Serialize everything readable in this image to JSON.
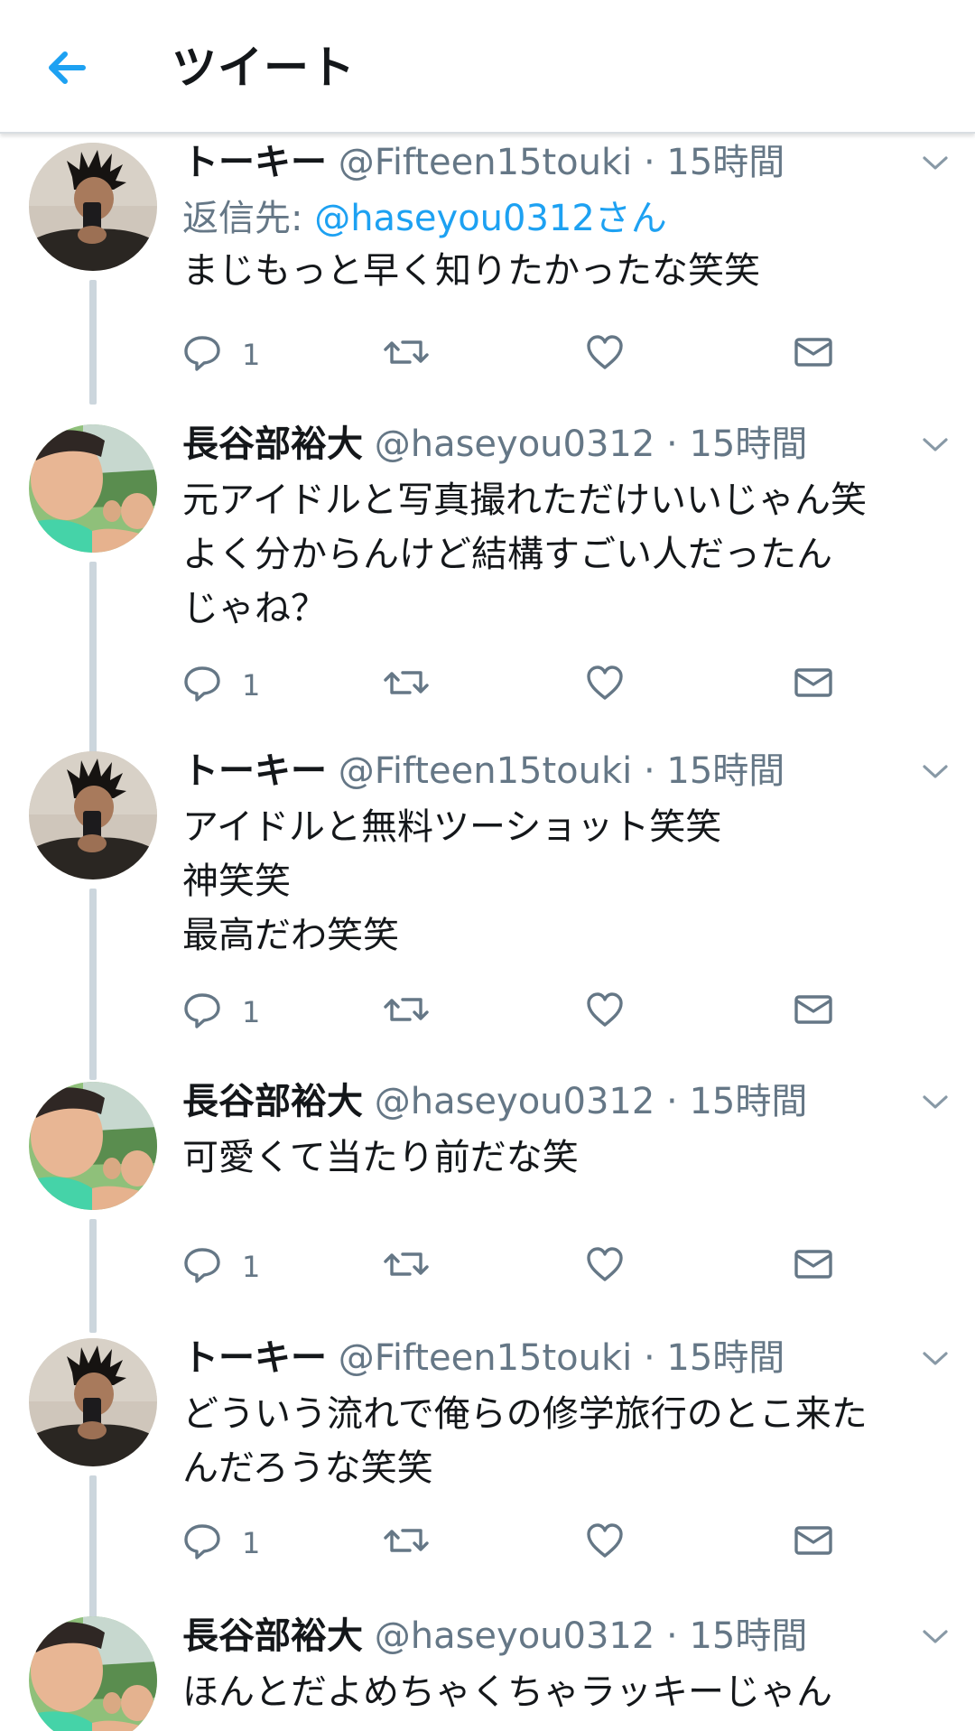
{
  "header": {
    "title": "ツイート",
    "back_icon": "arrow-left-icon",
    "accent_color": "#1da1f2"
  },
  "tweets": [
    {
      "name": "トーキー",
      "handle": "@Fifteen15touki",
      "separator": "·",
      "time": "15時間",
      "reply_to_prefix": "返信先: ",
      "reply_to_mention": "@haseyou0312さん",
      "lines": [
        "まじもっと早く知りたかったな笑笑"
      ],
      "reply_count": "1",
      "avatar": "avatar-touki"
    },
    {
      "name": "長谷部裕大",
      "handle": "@haseyou0312",
      "separator": "·",
      "time": "15時間",
      "lines": [
        "元アイドルと写真撮れただけいいじゃん笑",
        "よく分からんけど結構すごい人だったん",
        "じゃね？"
      ],
      "reply_count": "1",
      "avatar": "avatar-haseyou"
    },
    {
      "name": "トーキー",
      "handle": "@Fifteen15touki",
      "separator": "·",
      "time": "15時間",
      "lines": [
        "アイドルと無料ツーショット笑笑",
        "神笑笑",
        "最高だわ笑笑"
      ],
      "reply_count": "1",
      "avatar": "avatar-touki"
    },
    {
      "name": "長谷部裕大",
      "handle": "@haseyou0312",
      "separator": "·",
      "time": "15時間",
      "lines": [
        "可愛くて当たり前だな笑"
      ],
      "reply_count": "1",
      "avatar": "avatar-haseyou"
    },
    {
      "name": "トーキー",
      "handle": "@Fifteen15touki",
      "separator": "·",
      "time": "15時間",
      "lines": [
        "どういう流れで俺らの修学旅行のとこ来た",
        "んだろうな笑笑"
      ],
      "reply_count": "1",
      "avatar": "avatar-touki"
    },
    {
      "name": "長谷部裕大",
      "handle": "@haseyou0312",
      "separator": "·",
      "time": "15時間",
      "lines": [
        "ほんとだよめちゃくちゃラッキーじゃん"
      ],
      "avatar": "avatar-haseyou"
    }
  ],
  "icons": {
    "reply": "reply-bubble-icon",
    "retweet": "retweet-icon",
    "like": "heart-icon",
    "dm": "envelope-icon",
    "caret": "chevron-down-icon"
  },
  "colors": {
    "text": "#14171a",
    "secondary": "#657786",
    "mention": "#1da1f2",
    "thread_line": "#ccd6dd"
  }
}
